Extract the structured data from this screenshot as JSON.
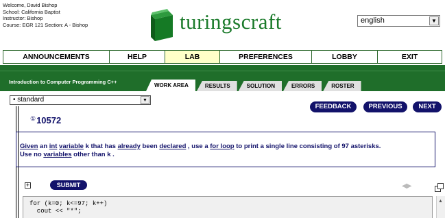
{
  "user": {
    "welcome": "Welcome, David Bishop",
    "school": "School: California Baptist",
    "instructor": "Instructor: Bishop",
    "course": "Course: EGR 121 Section: A - Bishop"
  },
  "brand": {
    "name": "turingscraft",
    "color": "#1a7a2a"
  },
  "language": {
    "selected": "english"
  },
  "nav": {
    "items": [
      {
        "label": "ANNOUNCEMENTS"
      },
      {
        "label": "HELP"
      },
      {
        "label": "LAB",
        "active": true
      },
      {
        "label": "PREFERENCES"
      },
      {
        "label": "LOBBY"
      },
      {
        "label": "EXIT"
      }
    ]
  },
  "course_title": "Introduction to Computer Programming C++",
  "tabs": [
    {
      "label": "WORK AREA",
      "active": true
    },
    {
      "label": "RESULTS"
    },
    {
      "label": "SOLUTION"
    },
    {
      "label": "ERRORS"
    },
    {
      "label": "ROSTER"
    }
  ],
  "mode": {
    "selected": "• standard"
  },
  "actions": {
    "feedback": "FEEDBACK",
    "previous": "PREVIOUS",
    "next": "NEXT"
  },
  "exercise": {
    "number": "10572",
    "info_glyph": "①"
  },
  "problem": {
    "w1": "Given",
    "t1": " an ",
    "w2": "int",
    "t2": " ",
    "w3": "variable",
    "t3": "  k that has ",
    "w4": "already",
    "t4": " been ",
    "w5": "declared",
    "t5": " , use a ",
    "w6": "for loop",
    "t6": "  to print a single line consisting of 97 asterisks.",
    "t7": "Use no ",
    "w7": "variables",
    "t8": " other than  k ."
  },
  "submit_label": "SUBMIT",
  "expand_glyph": "+",
  "arrows": "◀▶",
  "code": "for (k=0; k<=97; k++)\n  cout << \"*\";",
  "colors": {
    "green_band": "#1f6e2a",
    "navy": "#12126a",
    "lab_highlight": "#ffffc8"
  }
}
